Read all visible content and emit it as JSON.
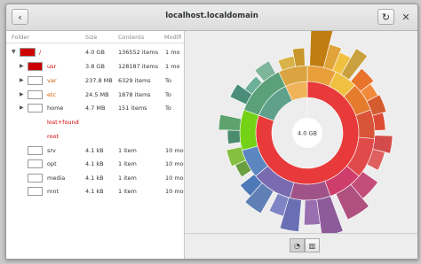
{
  "window": {
    "title": "localhost.localdomain"
  },
  "icons": {
    "back": "back-arrow-icon",
    "reload": "reload-icon",
    "close": "close-icon",
    "rings_view": "rings-chart-icon",
    "treemap_view": "treemap-chart-icon"
  },
  "columns": {
    "folder": "Folder",
    "size": "Size",
    "contents": "Contents",
    "modified": "Modifi"
  },
  "rows": [
    {
      "expander": "▼",
      "name": "/",
      "size": "4.0 GB",
      "contents": "136552 items",
      "modified": "1 mo",
      "color": "#cc0000",
      "name_color": "#cc0000"
    },
    {
      "expander": "▶",
      "name": "usr",
      "size": "3.8 GB",
      "contents": "128187 items",
      "modified": "1 mo",
      "color": "#cc0000",
      "name_color": "#cc0000"
    },
    {
      "expander": "▶",
      "name": "var",
      "size": "237.8 MB",
      "contents": "6329 items",
      "modified": "To",
      "color": "#ffffff",
      "name_color": "#ce5c00"
    },
    {
      "expander": "▶",
      "name": "etc",
      "size": "24.5 MB",
      "contents": "1878 items",
      "modified": "To",
      "color": "#ffffff",
      "name_color": "#ce5c00"
    },
    {
      "expander": "▶",
      "name": "home",
      "size": "4.7 MB",
      "contents": "151 items",
      "modified": "To",
      "color": "#ffffff",
      "name_color": "#2e3436"
    },
    {
      "expander": "",
      "name": "lost+found",
      "size": "",
      "contents": "",
      "modified": "",
      "color": "",
      "name_color": "#cc0000"
    },
    {
      "expander": "",
      "name": "root",
      "size": "",
      "contents": "",
      "modified": "",
      "color": "",
      "name_color": "#cc0000"
    },
    {
      "expander": "",
      "name": "srv",
      "size": "4.1 kB",
      "contents": "1 item",
      "modified": "10 mo",
      "color": "#ffffff",
      "name_color": "#2e3436"
    },
    {
      "expander": "",
      "name": "opt",
      "size": "4.1 kB",
      "contents": "1 item",
      "modified": "10 mo",
      "color": "#ffffff",
      "name_color": "#2e3436"
    },
    {
      "expander": "",
      "name": "media",
      "size": "4.1 kB",
      "contents": "1 item",
      "modified": "10 mo",
      "color": "#ffffff",
      "name_color": "#2e3436"
    },
    {
      "expander": "",
      "name": "mnt",
      "size": "4.1 kB",
      "contents": "1 item",
      "modified": "10 mo",
      "color": "#ffffff",
      "name_color": "#2e3436"
    }
  ],
  "chart": {
    "center_label": "4.0 GB",
    "colors": {
      "root": "#ef2929",
      "ring2": [
        "#ef2929",
        "#e23b3b"
      ],
      "green": "#73d216",
      "teal": "#5fa08a",
      "orange": "#f5a623",
      "gold": "#edd400",
      "brown": "#c17d11",
      "purple": "#75507b",
      "blue": "#3465a4"
    }
  }
}
